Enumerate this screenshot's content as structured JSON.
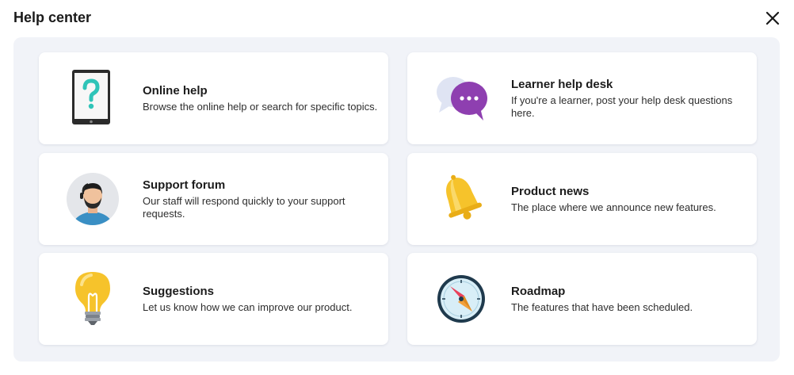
{
  "dialog": {
    "title": "Help center",
    "close_icon": "close-icon"
  },
  "cards": [
    {
      "title": "Online help",
      "description": "Browse the online help or search for specific topics.",
      "icon": "tablet-question-icon"
    },
    {
      "title": "Learner help desk",
      "description": "If you're a learner, post your help desk questions here.",
      "icon": "chat-bubbles-icon"
    },
    {
      "title": "Support forum",
      "description": "Our staff will respond quickly to your support requests.",
      "icon": "support-person-icon"
    },
    {
      "title": "Product news",
      "description": "The place where we announce new features.",
      "icon": "bell-icon"
    },
    {
      "title": "Suggestions",
      "description": "Let us know how we can improve our product.",
      "icon": "lightbulb-icon"
    },
    {
      "title": "Roadmap",
      "description": "The features that have been scheduled.",
      "icon": "compass-icon"
    }
  ],
  "colors": {
    "panel_background": "#f1f3f8",
    "card_background": "#ffffff",
    "bubble_purple": "#8e3fb0",
    "bell_yellow": "#f6c32b",
    "question_teal": "#2fc4b8",
    "shirt_blue": "#3a8fc4"
  }
}
